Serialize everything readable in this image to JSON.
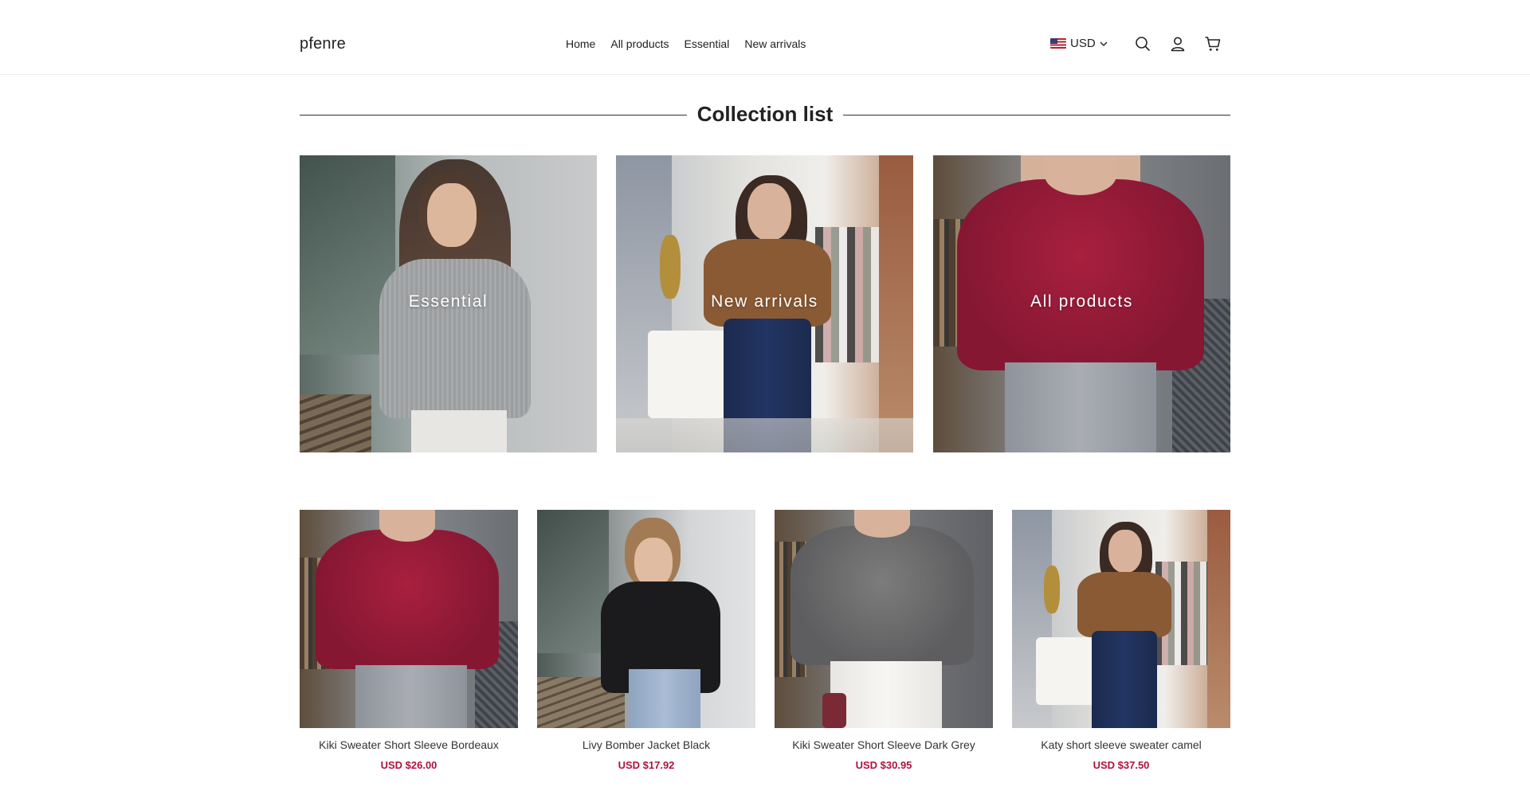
{
  "header": {
    "logo": "pfenre",
    "nav": [
      "Home",
      "All products",
      "Essential",
      "New arrivals"
    ],
    "currency": "USD",
    "icons": [
      "search-icon",
      "account-icon",
      "cart-icon"
    ]
  },
  "collection": {
    "title": "Collection list",
    "tiles": [
      {
        "label": "Essential"
      },
      {
        "label": "New arrivals"
      },
      {
        "label": "All products"
      }
    ]
  },
  "products": [
    {
      "name": "Kiki Sweater Short Sleeve Bordeaux",
      "price": "USD $26.00"
    },
    {
      "name": "Livy Bomber Jacket Black",
      "price": "USD $17.92"
    },
    {
      "name": "Kiki Sweater Short Sleeve Dark Grey",
      "price": "USD $30.95"
    },
    {
      "name": "Katy short sleeve sweater camel",
      "price": "USD $37.50"
    }
  ],
  "colors": {
    "price": "#b0123f",
    "divider": "#333333",
    "border": "#ececec"
  }
}
